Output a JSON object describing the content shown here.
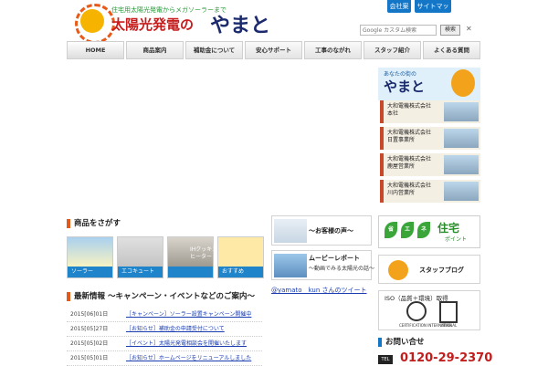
{
  "header": {
    "tagline": "住宅用太陽光発電からメガソーラーまで",
    "logo_main": "太陽光発電の",
    "logo_brand": "やまと",
    "top_links": [
      "会社案内",
      "サイトマップ"
    ]
  },
  "search": {
    "placeholder": "Google カスタム検索",
    "button_label": "検索",
    "clear_icon": "✕"
  },
  "nav": {
    "items": [
      "HOME",
      "商品案内",
      "補助金について",
      "安心サポート",
      "工事のながれ",
      "スタッフ紹介",
      "よくある質問"
    ]
  },
  "sidebar": {
    "mascot_small": "あなたの街の",
    "mascot_big": "やまと",
    "offices": [
      {
        "line1": "大和電機株式会社",
        "line2": "本社"
      },
      {
        "line1": "大和電機株式会社",
        "line2": "日置事業所"
      },
      {
        "line1": "大和電機株式会社",
        "line2": "鹿屋営業所"
      },
      {
        "line1": "大和電機株式会社",
        "line2": "川内営業所"
      }
    ]
  },
  "products": {
    "title": "商品をさがす",
    "items": [
      {
        "label": "ソーラー",
        "overlay": ""
      },
      {
        "label": "エコキュート",
        "overlay": ""
      },
      {
        "label": "",
        "overlay": "IHクッキング\nヒーター"
      },
      {
        "label": "おすすめ",
        "overlay": ""
      }
    ]
  },
  "news": {
    "title": "最新情報 ～キャンペーン・イベントなどのご案内～",
    "rows": [
      {
        "date": "2015[06]01日",
        "text": "［キャンペーン］ソーラー設置キャンペーン開催中"
      },
      {
        "date": "2015[05]27日",
        "text": "［お知らせ］補助金の申請受付について"
      },
      {
        "date": "2015[05]02日",
        "text": "［イベント］太陽光発電相談会を開催いたします"
      },
      {
        "date": "2015[05]01日",
        "text": "［お知らせ］ホームページをリニューアルしました"
      }
    ]
  },
  "middle": {
    "voice": "～お客様の声～",
    "movie_t1": "ムービーレポート",
    "movie_t2": "～動画でみる太陽光の話～",
    "twitter": "@yamato__kun さんのツイート"
  },
  "right": {
    "eco_leaves": [
      "省",
      "エ",
      "ネ"
    ],
    "eco_house": "住宅",
    "eco_point": "ポイント",
    "blog": "スタッフブログ",
    "iso_title": "ISO（品質＋環境）取得",
    "iso_sub1": "CERTIFICATION INTERNATIONAL",
    "iso_sub2": "UKAS",
    "contact_title": "お問い合せ",
    "tel_label": "TEL",
    "tel_number": "0120-29-2370"
  },
  "colors": {
    "accent_blue": "#1476c6",
    "accent_red": "#c11d1d",
    "accent_orange": "#e35b1a",
    "accent_green": "#3aa63a"
  }
}
